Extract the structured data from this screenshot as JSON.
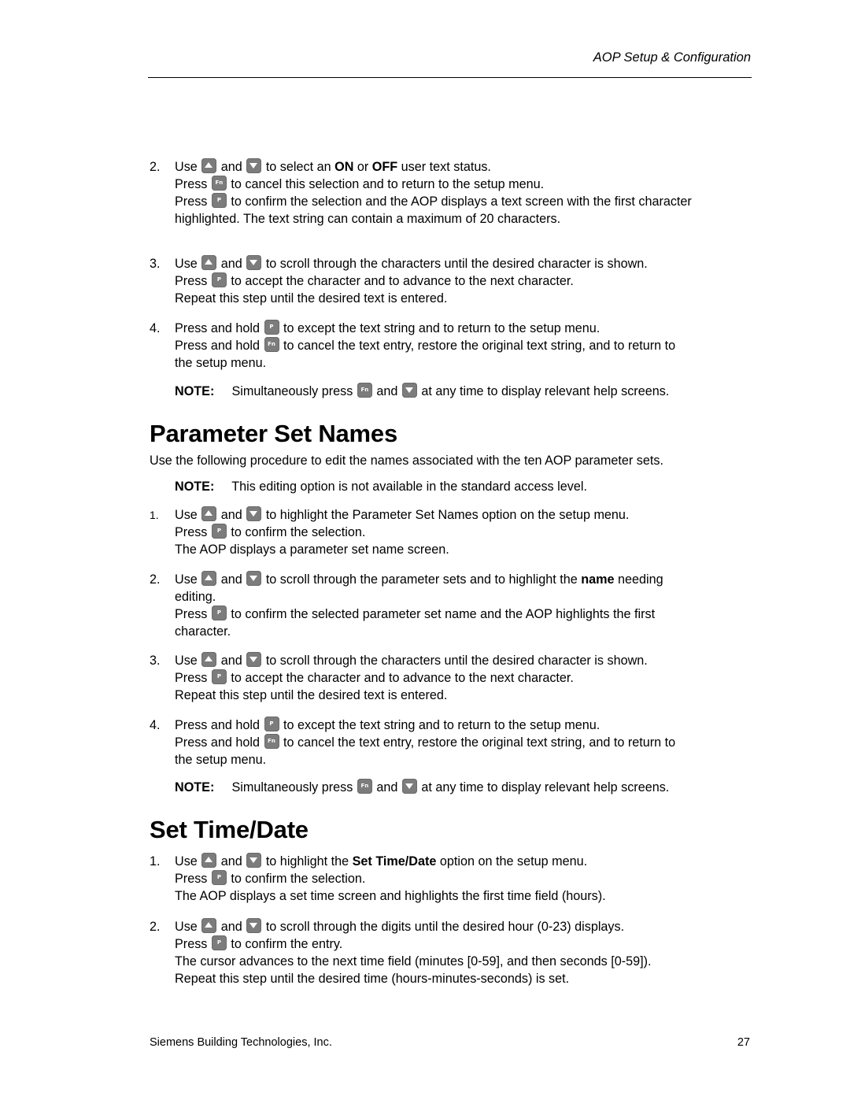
{
  "header": {
    "section_title": "AOP Setup & Configuration"
  },
  "keys": {
    "up": "up-arrow-key",
    "down": "down-arrow-key",
    "fn": "Fn",
    "p": "P"
  },
  "user_text_steps": {
    "step2": {
      "num": "2.",
      "l1_a": "Use",
      "l1_b": "and",
      "l1_c": "to select an",
      "l1_on": "ON",
      "l1_or": "or",
      "l1_off": "OFF",
      "l1_d": "user text status.",
      "l2_a": "Press",
      "l2_b": "to cancel this selection and to return to the setup menu.",
      "l3_a": "Press",
      "l3_b": "to confirm the selection and the AOP displays a text screen with the first character",
      "l4": "highlighted. The text string can contain a maximum of 20 characters."
    },
    "step3": {
      "num": "3.",
      "l1_a": "Use",
      "l1_b": "and",
      "l1_c": "to scroll through the characters until the desired character is shown.",
      "l2_a": "Press",
      "l2_b": "to accept the character and to advance to the next character.",
      "l3": "Repeat this step until the desired text is entered."
    },
    "step4": {
      "num": "4.",
      "l1_a": "Press and hold",
      "l1_b": "to except the text string and to return to the setup menu.",
      "l2_a": "Press and hold",
      "l2_b": "to cancel the text entry, restore the original text string, and to return to",
      "l3": "the setup menu."
    },
    "note": {
      "label": "NOTE:",
      "a": "Simultaneously press",
      "b": "and",
      "c": "at any time to display relevant help screens."
    }
  },
  "parameter_set_names": {
    "heading": "Parameter Set Names",
    "intro": "Use the following procedure to edit the names associated with the ten AOP parameter sets.",
    "note": {
      "label": "NOTE:",
      "text": "This editing option is not available in the standard access level."
    },
    "step1": {
      "num": "1.",
      "l1_a": "Use",
      "l1_b": "and",
      "l1_c": "to highlight the Parameter Set Names option on the setup menu.",
      "l2_a": "Press",
      "l2_b": "to confirm the selection.",
      "l3": "The AOP displays a parameter set name screen."
    },
    "step2": {
      "num": "2.",
      "l1_a": "Use",
      "l1_b": "and",
      "l1_c": "to scroll through the parameter sets and to highlight the",
      "l1_bold": "name",
      "l1_d": "needing",
      "l2": "editing.",
      "l3_a": "Press",
      "l3_b": "to confirm the selected parameter set name and the AOP highlights the first",
      "l4": "character."
    },
    "step3": {
      "num": "3.",
      "l1_a": "Use",
      "l1_b": "and",
      "l1_c": "to scroll through the characters until the desired character is shown.",
      "l2_a": "Press",
      "l2_b": "to accept the character and to advance to the next character.",
      "l3": "Repeat this step until the desired text is entered."
    },
    "step4": {
      "num": "4.",
      "l1_a": "Press and hold",
      "l1_b": "to except the text string and to return to the setup menu.",
      "l2_a": "Press and hold",
      "l2_b": "to cancel the text entry, restore the original text string, and to return to",
      "l3": "the setup menu."
    },
    "note2": {
      "label": "NOTE:",
      "a": "Simultaneously press",
      "b": "and",
      "c": "at any time to display relevant help screens."
    }
  },
  "set_time_date": {
    "heading": "Set Time/Date",
    "step1": {
      "num": "1.",
      "l1_a": "Use",
      "l1_b": "and",
      "l1_c": "to highlight the",
      "l1_bold": "Set Time/Date",
      "l1_d": "option on the setup menu.",
      "l2_a": "Press",
      "l2_b": "to confirm the selection.",
      "l3": "The AOP displays a set time screen and highlights the first time field (hours)."
    },
    "step2": {
      "num": "2.",
      "l1_a": "Use",
      "l1_b": "and",
      "l1_c": "to scroll through the digits until the desired hour (0-23) displays.",
      "l2_a": "Press",
      "l2_b": "to confirm the entry.",
      "l3": "The cursor advances to the next time field (minutes [0-59], and then seconds [0-59]).",
      "l4": "Repeat this step until the desired time (hours-minutes-seconds) is set."
    }
  },
  "footer": {
    "company": "Siemens Building Technologies, Inc.",
    "page_number": "27"
  }
}
